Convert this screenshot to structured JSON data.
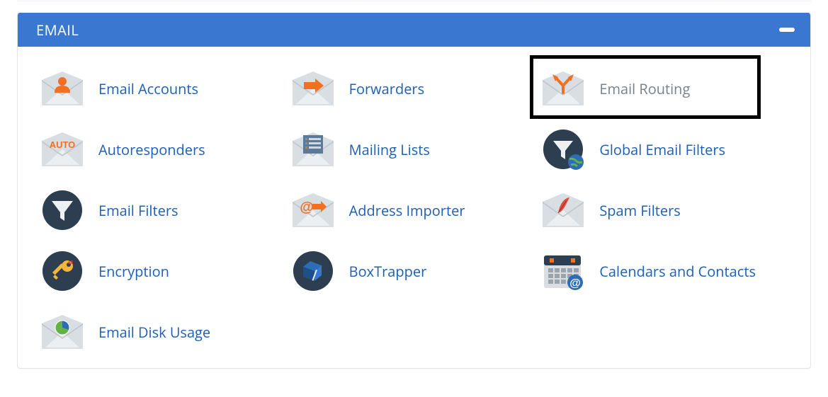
{
  "section": {
    "title": "EMAIL",
    "colors": {
      "header_bg": "#3a77d0",
      "link": "#1b5fb8",
      "muted": "#7b818a",
      "accent_orange": "#f36f21",
      "navy": "#2c3e50"
    },
    "highlighted_item_index": 2,
    "items": [
      {
        "label": "Email Accounts",
        "icon": "envelope-person-icon",
        "name": "email-accounts"
      },
      {
        "label": "Forwarders",
        "icon": "envelope-arrow-icon",
        "name": "forwarders"
      },
      {
        "label": "Email Routing",
        "icon": "envelope-branch-icon",
        "name": "email-routing"
      },
      {
        "label": "Autoresponders",
        "icon": "envelope-auto-icon",
        "name": "autoresponders"
      },
      {
        "label": "Mailing Lists",
        "icon": "envelope-list-icon",
        "name": "mailing-lists"
      },
      {
        "label": "Global Email Filters",
        "icon": "funnel-globe-icon",
        "name": "global-email-filters"
      },
      {
        "label": "Email Filters",
        "icon": "funnel-icon",
        "name": "email-filters"
      },
      {
        "label": "Address Importer",
        "icon": "envelope-at-arrow-icon",
        "name": "address-importer"
      },
      {
        "label": "Spam Filters",
        "icon": "envelope-feather-icon",
        "name": "spam-filters"
      },
      {
        "label": "Encryption",
        "icon": "key-icon",
        "name": "encryption"
      },
      {
        "label": "BoxTrapper",
        "icon": "box-trap-icon",
        "name": "boxtrapper"
      },
      {
        "label": "Calendars and Contacts",
        "icon": "calendar-at-icon",
        "name": "calendars-and-contacts"
      },
      {
        "label": "Email Disk Usage",
        "icon": "envelope-pie-icon",
        "name": "email-disk-usage"
      }
    ]
  }
}
